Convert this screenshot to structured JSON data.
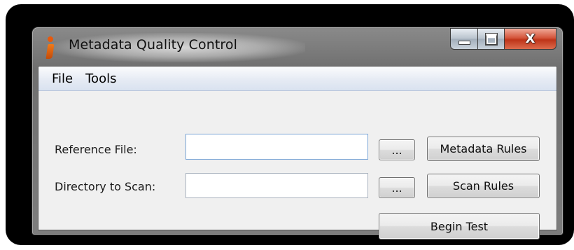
{
  "window": {
    "title": "Metadata Quality Control",
    "close_glyph": "X"
  },
  "menu": [
    "File",
    "Tools"
  ],
  "form": {
    "reference_label": "Reference File:",
    "reference_value": "",
    "directory_label": "Directory to Scan:",
    "directory_value": "",
    "browse_label": "...",
    "metadata_rules_label": "Metadata Rules",
    "scan_rules_label": "Scan Rules",
    "begin_test_label": "Begin Test"
  },
  "colors": {
    "accent": "#e8590c",
    "close_button": "#c7401f",
    "menubar": "#dfe6f2"
  },
  "icons": [
    "app-icon",
    "minimize-icon",
    "maximize-icon",
    "close-icon"
  ]
}
